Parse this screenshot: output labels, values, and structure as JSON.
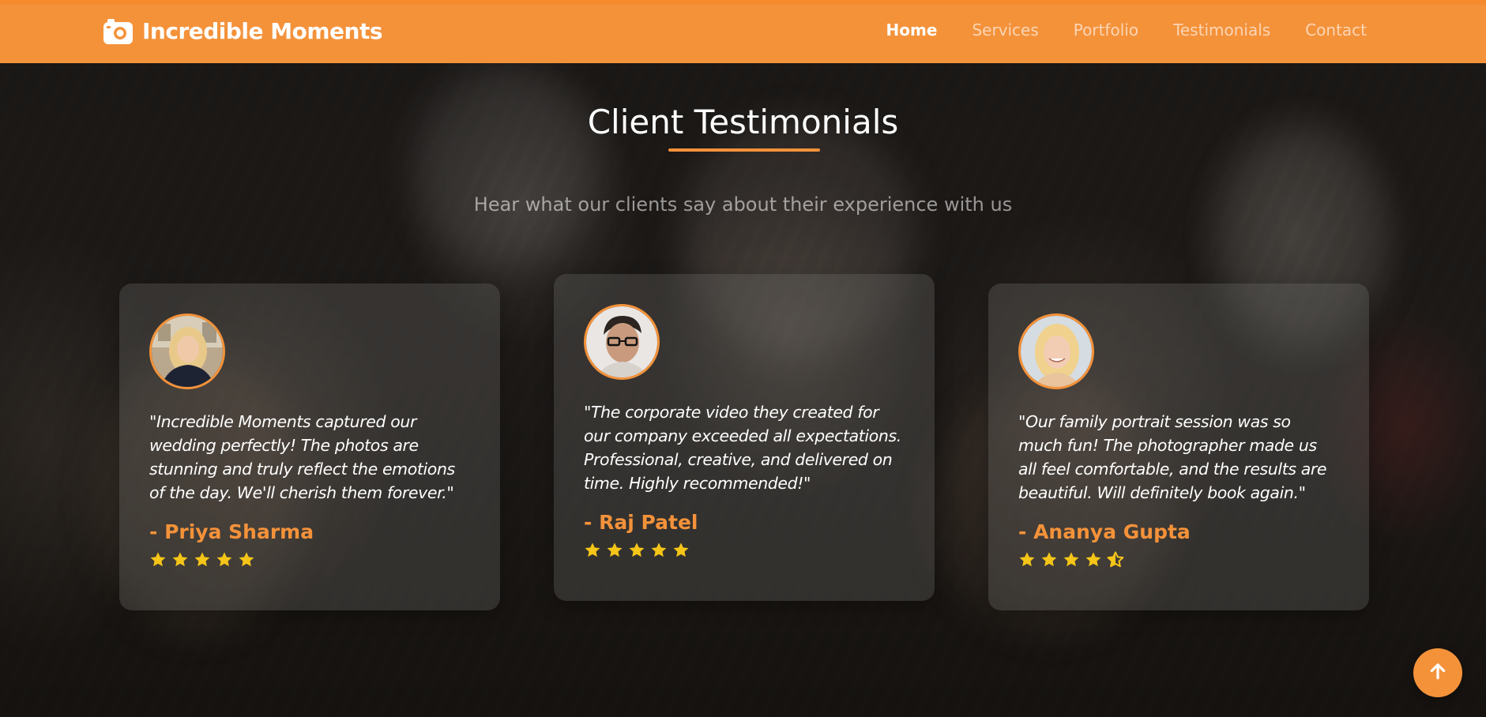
{
  "brand": {
    "name": "Incredible Moments",
    "icon": "camera-icon"
  },
  "nav": {
    "items": [
      {
        "label": "Home",
        "active": true
      },
      {
        "label": "Services",
        "active": false
      },
      {
        "label": "Portfolio",
        "active": false
      },
      {
        "label": "Testimonials",
        "active": false
      },
      {
        "label": "Contact",
        "active": false
      }
    ]
  },
  "section": {
    "title": "Client Testimonials",
    "subtitle": "Hear what our clients say about their experience with us"
  },
  "testimonials": [
    {
      "quote": "\"Incredible Moments captured our wedding perfectly! The photos are stunning and truly reflect the emotions of the day. We'll cherish them forever.\"",
      "author": "- Priya Sharma",
      "rating": 5
    },
    {
      "quote": "\"The corporate video they created for our company exceeded all expectations. Professional, creative, and delivered on time. Highly recommended!\"",
      "author": "- Raj Patel",
      "rating": 5
    },
    {
      "quote": "\"Our family portrait session was so much fun! The photographer made us all feel comfortable, and the results are beautiful. Will definitely book again.\"",
      "author": "- Ananya Gupta",
      "rating": 4.5
    }
  ],
  "colors": {
    "accent": "#f4923a",
    "star": "#f5c518"
  },
  "back_to_top": {
    "icon": "arrow-up-icon"
  }
}
